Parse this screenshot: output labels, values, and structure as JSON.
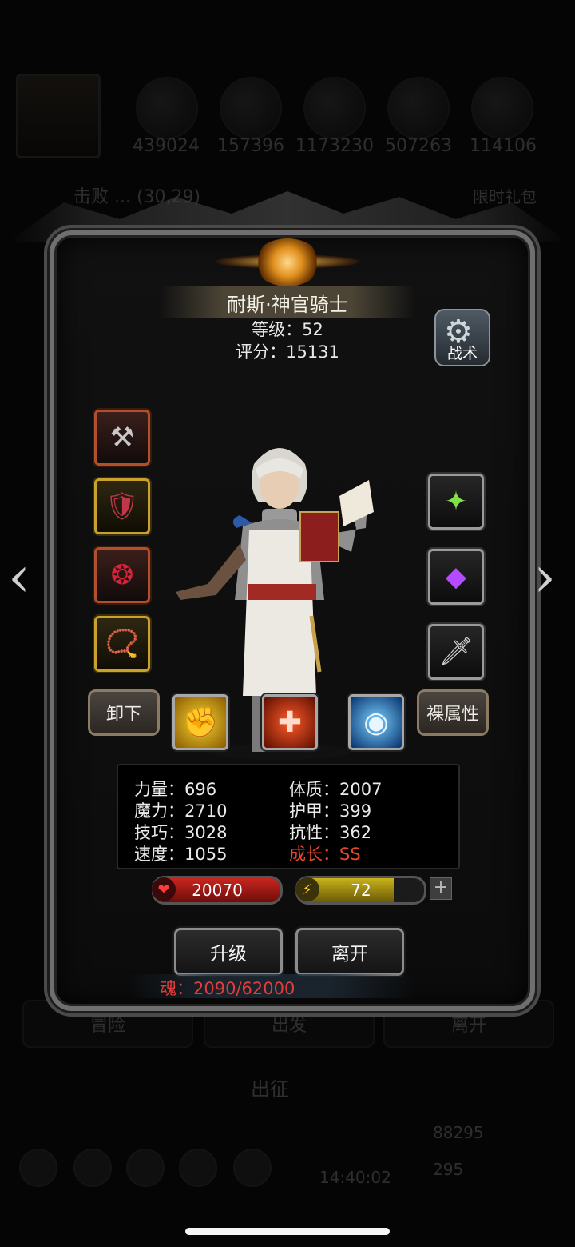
{
  "background": {
    "resources": [
      "439024",
      "157396",
      "1173230",
      "507263",
      "114106"
    ],
    "quest": "击败 ... (30,29)",
    "side_button": "限时礼包",
    "tabs": [
      "冒险",
      "出发",
      "离开"
    ],
    "expedition": "出征",
    "timer": "14:40:02",
    "currency_1": "88295",
    "currency_2": "295"
  },
  "hero": {
    "name": "耐斯·神官骑士",
    "level_text": "等级：52",
    "score_text": "评分：15131"
  },
  "tactic_button": {
    "label": "战术",
    "icon": "gear-icon"
  },
  "equipment": {
    "left": [
      {
        "icon": "hammer-icon",
        "glyph": "⚒",
        "tier": "red"
      },
      {
        "icon": "chest-armor-icon",
        "glyph": "🛡",
        "tier": "gold"
      },
      {
        "icon": "red-amulet-icon",
        "glyph": "❂",
        "tier": "red"
      },
      {
        "icon": "necklace-icon",
        "glyph": "📿",
        "tier": "gold"
      }
    ],
    "right": [
      {
        "icon": "green-relic-icon",
        "glyph": "✦",
        "tier": "grey"
      },
      {
        "icon": "purple-gem-icon",
        "glyph": "◆",
        "tier": "grey"
      },
      {
        "icon": "dagger-icon",
        "glyph": "🗡",
        "tier": "grey"
      }
    ]
  },
  "buttons": {
    "unequip": "卸下",
    "bare_stats": "裸属性",
    "upgrade": "升级",
    "leave": "离开"
  },
  "skills": [
    {
      "icon": "fist-icon",
      "glyph": "✊",
      "color": "#f2c21a"
    },
    {
      "icon": "red-cross-icon",
      "glyph": "✚",
      "color": "#e8401f"
    },
    {
      "icon": "eye-icon",
      "glyph": "◉",
      "color": "#3aa0ff"
    }
  ],
  "stats": {
    "strength": "力量：696",
    "magic": "魔力：2710",
    "skill": "技巧：3028",
    "speed": "速度：1055",
    "constitution": "体质：2007",
    "armor": "护甲：399",
    "resistance": "抗性：362",
    "growth": "成长：SS"
  },
  "hp": {
    "value": "20070",
    "fill_pct": 100,
    "color": "#c8261f"
  },
  "energy": {
    "value": "72",
    "fill_pct": 76,
    "color": "#c8b21c"
  },
  "soul": "魂：2090/62000",
  "nav": {
    "prev": "‹",
    "next": "›"
  }
}
